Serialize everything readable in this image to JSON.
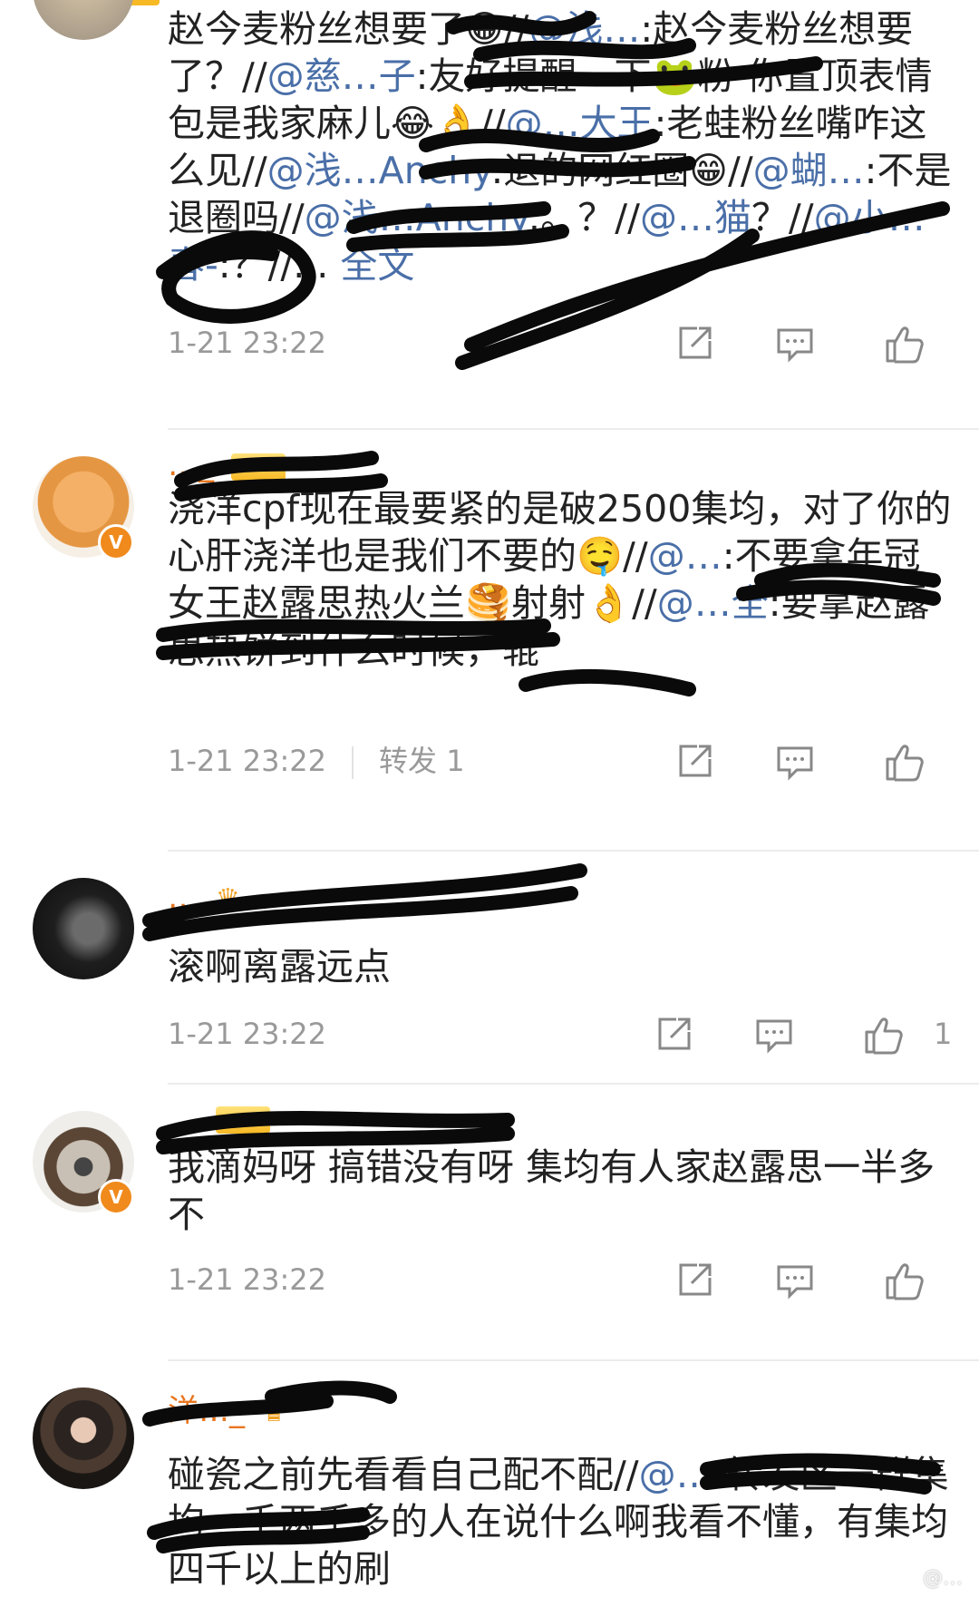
{
  "posts": [
    {
      "username": "",
      "text": [
        {
          "t": "赵今麦粉丝想要了😁//"
        },
        {
          "t": "@浅…",
          "m": true
        },
        {
          "t": ":赵今麦粉丝想要了？//"
        },
        {
          "t": "@慈…子",
          "m": true
        },
        {
          "t": ":友好提醒一下🐸粉 你置顶表情包是我家麻儿😂👌//"
        },
        {
          "t": "@…大王",
          "m": true
        },
        {
          "t": ":老蛙粉丝嘴咋这么见//"
        },
        {
          "t": "@浅…Anchy",
          "m": true
        },
        {
          "t": ":退的网红圈😁//"
        },
        {
          "t": "@蝴…",
          "m": true
        },
        {
          "t": ":不是退圈吗//"
        },
        {
          "t": "@浅…Anchy",
          "m": true
        },
        {
          "t": ":。？//"
        },
        {
          "t": "@…猫",
          "m": true
        },
        {
          "t": "？//"
        },
        {
          "t": "@小…春-",
          "m": true
        },
        {
          "t": ":？//..."
        }
      ],
      "more_label": "全文",
      "time": "1-21 23:22",
      "repost_label": "",
      "like_count": ""
    },
    {
      "username": "…_",
      "level_label": "",
      "verified_label": "V",
      "text": [
        {
          "t": "浇洋cpf现在最要紧的是破2500集均，对了你的心肝浇洋也是我们不要的🤤//"
        },
        {
          "t": "@…",
          "m": true
        },
        {
          "t": ":不要拿年冠女王赵露思热火兰🥞射射👌//"
        },
        {
          "t": "@…全",
          "m": true
        },
        {
          "t": ":要拿赵露思热饼到什么时候，辊"
        }
      ],
      "time": "1-21 23:22",
      "repost_label": "转发 1",
      "like_count": ""
    },
    {
      "username": "…",
      "text": [
        {
          "t": "滚啊离露远点"
        }
      ],
      "time": "1-21 23:22",
      "repost_label": "",
      "like_count": "1"
    },
    {
      "username": "…",
      "level_label": "",
      "verified_label": "V",
      "text": [
        {
          "t": "我滴妈呀 搞错没有呀 集均有人家赵露思一半多不"
        }
      ],
      "time": "1-21 23:22",
      "repost_label": "",
      "like_count": ""
    },
    {
      "username": "洋…_",
      "text": [
        {
          "t": "碰瓷之前先看看自己配不配//"
        },
        {
          "t": "@…",
          "m": true
        },
        {
          "t": ":转发区一群集均一千两千多的人在说什么啊我看不懂，有集均四千以上的刷"
        }
      ],
      "time": "",
      "repost_label": "",
      "like_count": ""
    }
  ],
  "watermark": "@…",
  "colors": {
    "link": "#4a6fa8",
    "username": "#e8761f",
    "meta": "#999999",
    "verified": "#f08a1c"
  },
  "icons": {
    "repost": "share-out-icon",
    "comment": "comment-icon",
    "like": "thumbs-up-icon"
  }
}
